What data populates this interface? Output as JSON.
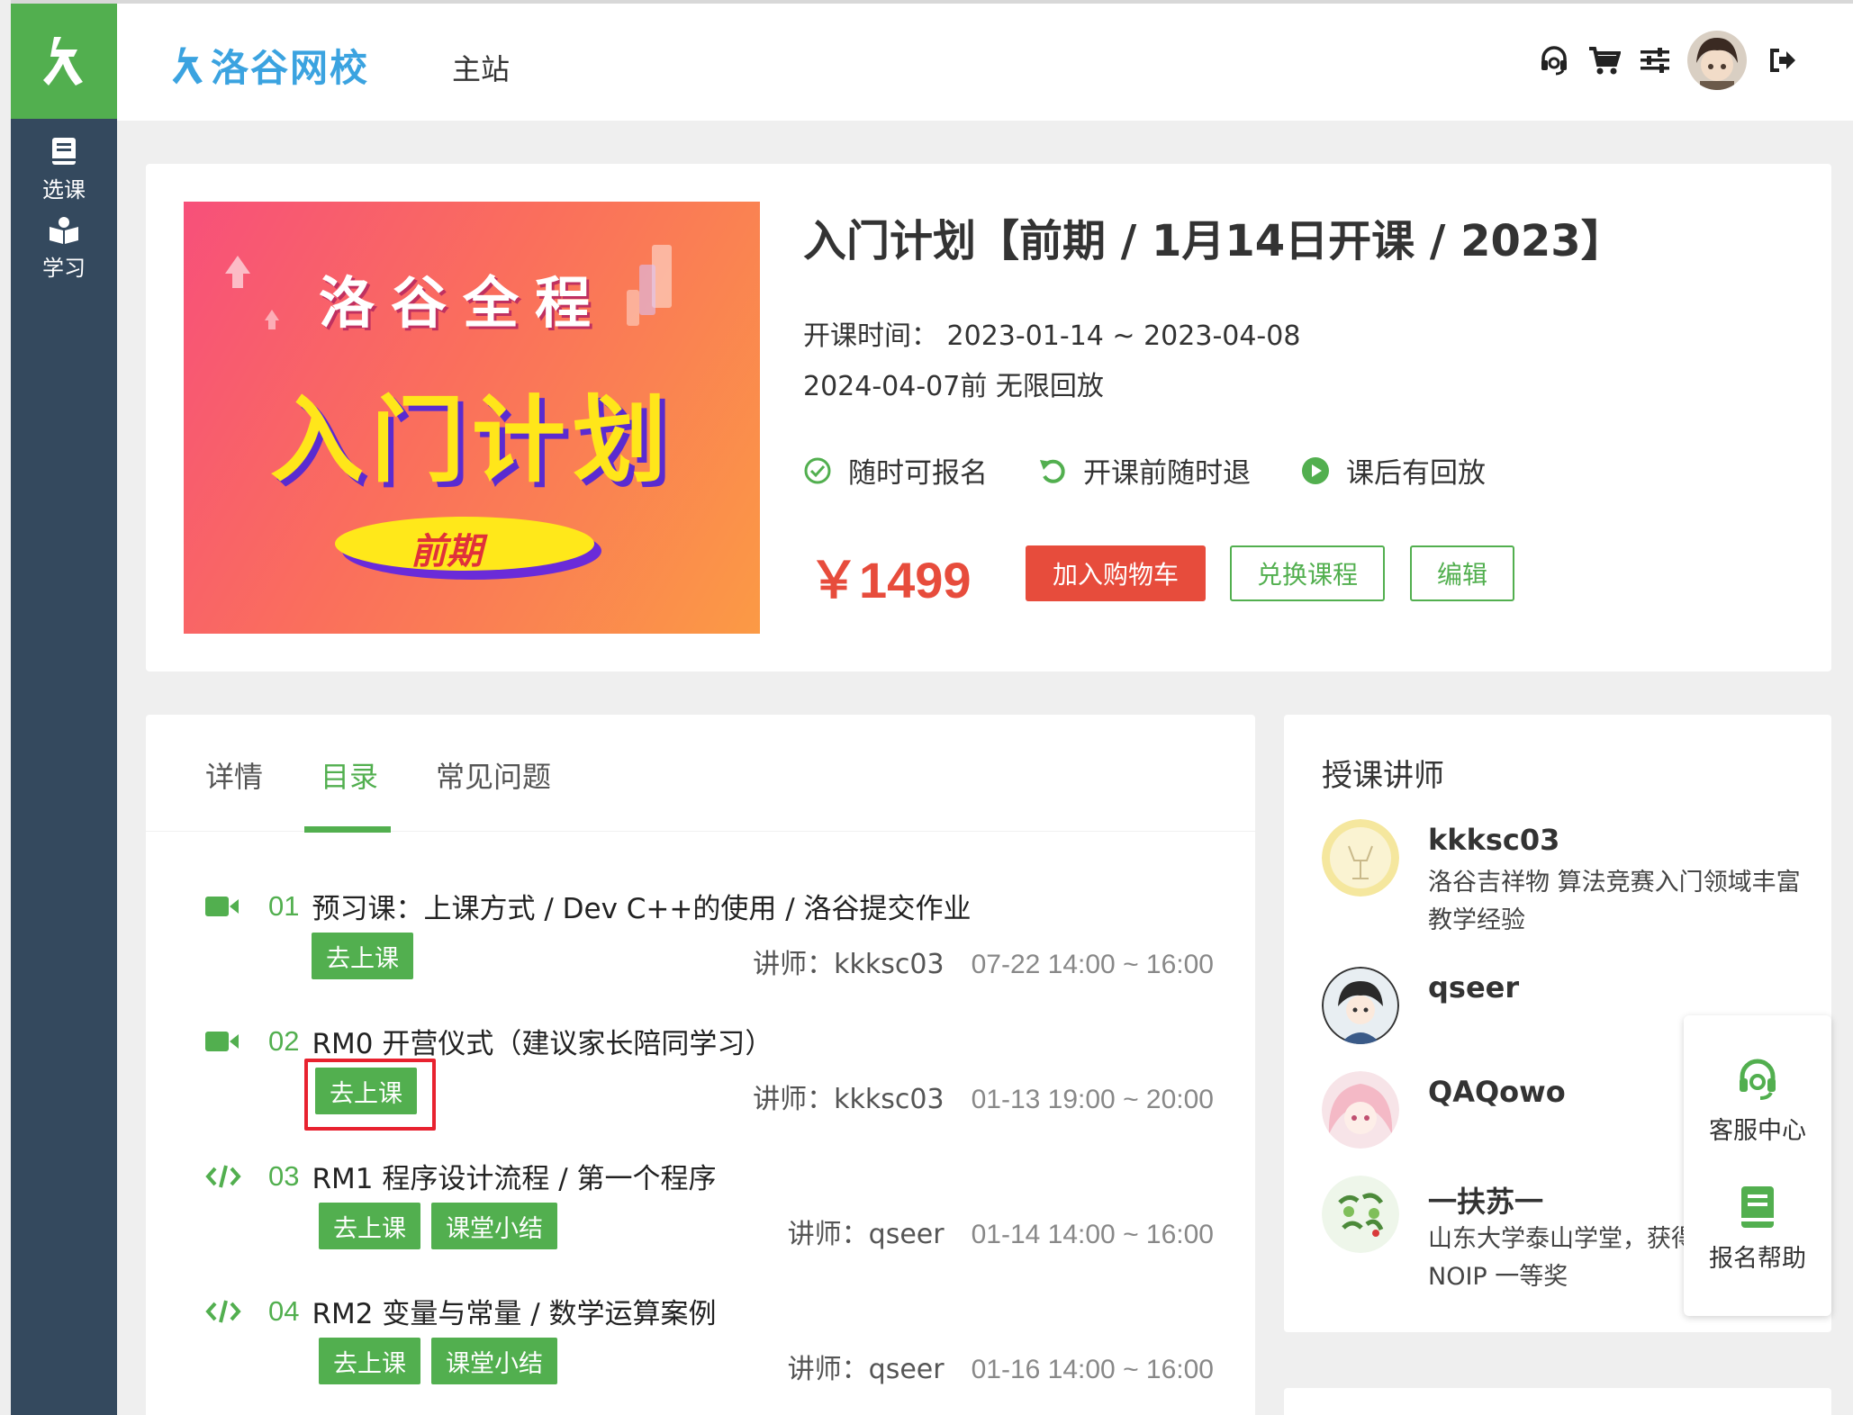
{
  "header": {
    "brand_name": "洛谷网校",
    "main_site_label": "主站",
    "icons": [
      "headset-icon",
      "cart-icon",
      "settings-sliders-icon",
      "avatar",
      "logout-icon"
    ]
  },
  "sidebar": {
    "items": [
      {
        "label": "选课",
        "icon": "book-icon"
      },
      {
        "label": "学习",
        "icon": "learning-icon"
      }
    ]
  },
  "course": {
    "title": "入门计划【前期 / 1月14日开课 / 2023】",
    "time_line1": "开课时间：  2023-01-14 ~ 2023-04-08",
    "time_line2": "2024-04-07前 无限回放",
    "features": [
      {
        "label": "随时可报名",
        "icon": "check-circle-icon"
      },
      {
        "label": "开课前随时退",
        "icon": "undo-icon"
      },
      {
        "label": "课后有回放",
        "icon": "play-circle-icon"
      }
    ],
    "price": "￥1499",
    "add_to_cart_label": "加入购物车",
    "redeem_label": "兑换课程",
    "edit_label": "编辑",
    "banner": {
      "brand_line": "洛谷全程",
      "big_title": "入门计划",
      "tag": "前期"
    }
  },
  "tabs": [
    {
      "label": "详情",
      "active": false
    },
    {
      "label": "目录",
      "active": true
    },
    {
      "label": "常见问题",
      "active": false
    }
  ],
  "lessons": [
    {
      "num": "01",
      "title": "预习课：上课方式 / Dev C++的使用 / 洛谷提交作业",
      "type": "video-icon",
      "buttons": [
        "去上课"
      ],
      "teacher": "讲师：kkksc03",
      "time": "07-22 14:00 ~ 16:00"
    },
    {
      "num": "02",
      "title": "RM0 开营仪式（建议家长陪同学习）",
      "type": "video-icon",
      "buttons": [
        "去上课"
      ],
      "teacher": "讲师：kkksc03",
      "time": "01-13 19:00 ~ 20:00"
    },
    {
      "num": "03",
      "title": "RM1 程序设计流程 / 第一个程序",
      "type": "code-icon",
      "buttons": [
        "去上课",
        "课堂小结"
      ],
      "teacher": "讲师：qseer",
      "time": "01-14 14:00 ~ 16:00"
    },
    {
      "num": "04",
      "title": "RM2 变量与常量 / 数学运算案例",
      "type": "code-icon",
      "buttons": [
        "去上课",
        "课堂小结"
      ],
      "teacher": "讲师：qseer",
      "time": "01-16 14:00 ~ 16:00"
    }
  ],
  "teachers": {
    "title": "授课讲师",
    "list": [
      {
        "name": "kkksc03",
        "desc": "洛谷吉祥物 算法竞赛入门领域丰富教学经验",
        "avatar_color": "#f5e79e"
      },
      {
        "name": "qseer",
        "desc": "",
        "avatar_color": "#e8eef2"
      },
      {
        "name": "QAQowo",
        "desc": "",
        "avatar_color": "#f7c9d3"
      },
      {
        "name": "一扶苏一",
        "desc": "山东大学泰山学堂，获得 NOIP 一等奖",
        "avatar_color": "#cfe6c4"
      }
    ]
  },
  "float_help": {
    "service_label": "客服中心",
    "signup_help_label": "报名帮助"
  },
  "colors": {
    "brand_green": "#52af4f",
    "sidebar_bg": "#34495e",
    "price_red": "#e74c3c",
    "highlight_red": "#e8222f"
  }
}
